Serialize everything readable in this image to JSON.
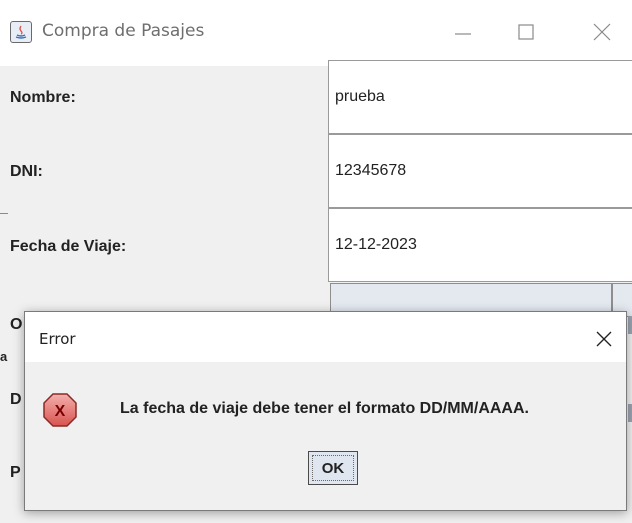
{
  "window": {
    "title": "Compra de Pasajes",
    "icon": "java-icon"
  },
  "form": {
    "fields": [
      {
        "label": "Nombre:",
        "value": "prueba"
      },
      {
        "label": "DNI:",
        "value": "12345678"
      },
      {
        "label": "Fecha de Viaje:",
        "value": "12-12-2023"
      }
    ],
    "partial_labels": [
      "O",
      "D",
      "P"
    ],
    "side_letter": "a"
  },
  "dialog": {
    "title": "Error",
    "icon": "error-icon",
    "icon_glyph": "X",
    "message": "La fecha de viaje debe tener el formato DD/MM/AAAA.",
    "ok_label": "OK",
    "accent": "#d9534f"
  }
}
